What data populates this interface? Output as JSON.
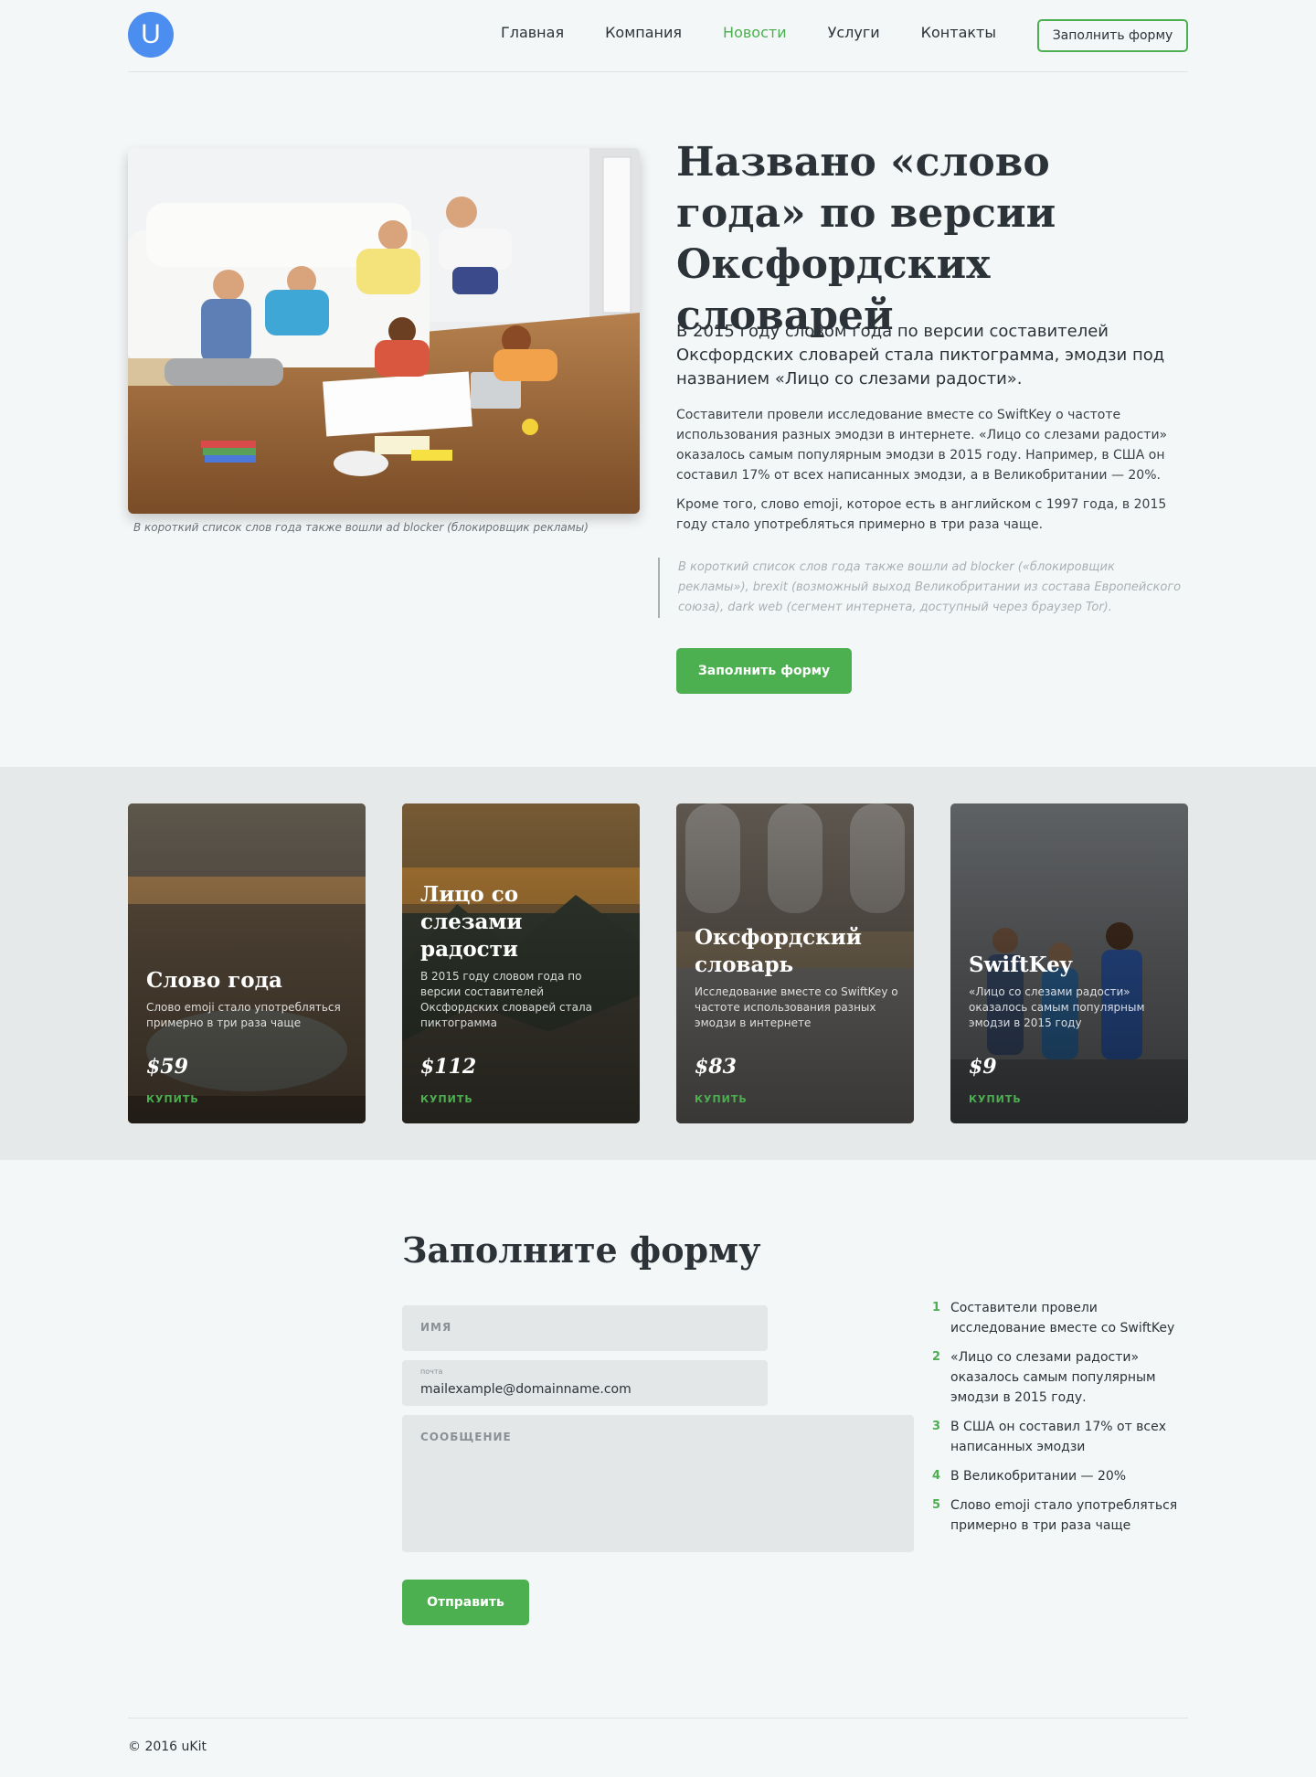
{
  "header": {
    "logo_letter": "U",
    "nav": [
      "Главная",
      "Компания",
      "Новости",
      "Услуги",
      "Контакты"
    ],
    "active_nav": "Новости",
    "form_button": "Заполнить форму"
  },
  "hero": {
    "image_caption": "В короткий список слов года также вошли ad blocker (блокировщик рекламы)",
    "title": "Названо «слово года» по версии Оксфордских словарей",
    "lead": "В 2015 году словом года по версии составителей Оксфордских словарей стала пиктограмма, эмодзи под названием «Лицо со слезами радости».",
    "paragraph1": "Составители провели исследование вместе со SwiftKey о частоте использования разных эмодзи в интернете. «Лицо со слезами радости» оказалось самым популярным эмодзи в 2015 году. Например, в США он составил 17% от всех написанных эмодзи, а в Великобритании — 20%.",
    "paragraph2": "Кроме того, слово emoji, которое есть в английском с 1997 года, в 2015 году стало употребляться примерно в три раза чаще.",
    "quote": "В короткий список слов года также вошли ad blocker («блокировщик рекламы»), brexit (возможный выход Великобритании из состава Европейского союза), dark web (сегмент интернета, доступный через браузер Tor).",
    "button": "Заполнить форму"
  },
  "cards": [
    {
      "title": "Слово года",
      "desc": "Слово emoji стало употребляться примерно в три раза чаще",
      "price": "$59",
      "buy": "КУПИТЬ"
    },
    {
      "title": "Лицо со слезами радости",
      "desc": "В 2015 году словом года по версии составителей Оксфордских словарей стала пиктограмма",
      "price": "$112",
      "buy": "КУПИТЬ"
    },
    {
      "title": "Оксфордский словарь",
      "desc": "Исследование вместе со SwiftKey о частоте использования разных эмодзи в интернете",
      "price": "$83",
      "buy": "КУПИТЬ"
    },
    {
      "title": "SwiftKey",
      "desc": "«Лицо со слезами радости» оказалось самым популярным эмодзи в 2015 году",
      "price": "$9",
      "buy": "КУПИТЬ"
    }
  ],
  "form": {
    "title": "Заполните форму",
    "name_placeholder": "ИМЯ",
    "email_label": "почта",
    "email_value": "mailexample@domainname.com",
    "message_placeholder": "СООБЩЕНИЕ",
    "submit": "Отправить"
  },
  "facts": [
    {
      "num": "1",
      "text": "Составители провели исследование вместе со SwiftKey"
    },
    {
      "num": "2",
      "text": "«Лицо со слезами радости» оказалось самым популярным эмодзи в 2015 году."
    },
    {
      "num": "3",
      "text": "В США он составил 17% от всех написанных эмодзи"
    },
    {
      "num": "4",
      "text": "В Великобритании — 20%"
    },
    {
      "num": "5",
      "text": "Слово emoji стало употребляться примерно в три раза чаще"
    }
  ],
  "footer": {
    "copyright": "© 2016 uKit"
  },
  "colors": {
    "accent": "#4caf50",
    "logo": "#4c8df0",
    "background": "#f4f7f8",
    "band": "#e6e9ea"
  }
}
